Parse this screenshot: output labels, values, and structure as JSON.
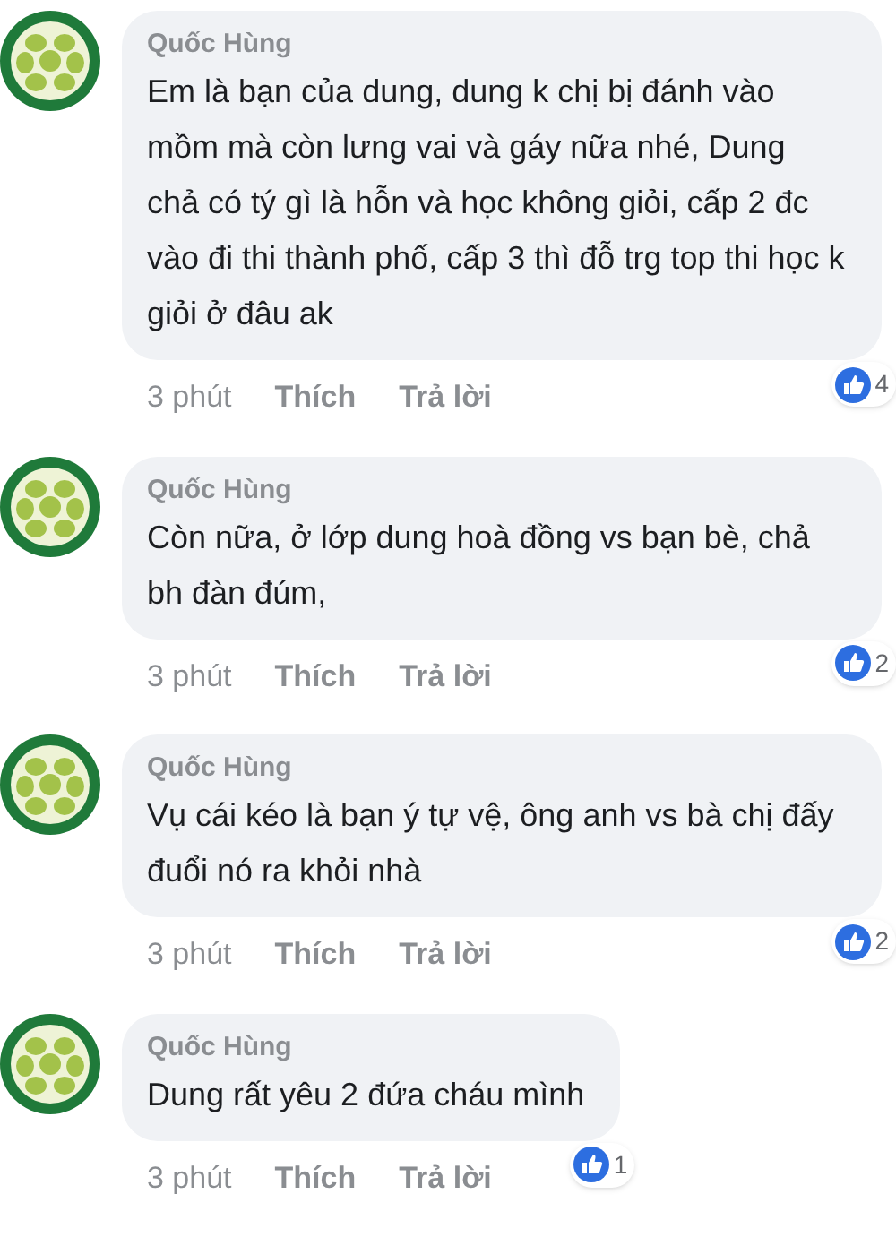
{
  "comments": [
    {
      "author": "Quốc Hùng",
      "text": "Em là bạn của dung, dung k chị bị đánh vào mồm mà còn lưng vai và gáy nữa nhé, Dung chả có tý gì là hỗn và học không giỏi, cấp 2 đc vào đi thi thành phố, cấp 3 thì đỗ trg top thi học k giỏi ở đâu ak",
      "time": "3 phút",
      "like": "Thích",
      "reply": "Trả lời",
      "reactions": "4"
    },
    {
      "author": "Quốc Hùng",
      "text": "Còn nữa, ở lớp dung hoà đồng vs bạn bè, chả bh đàn đúm,",
      "time": "3 phút",
      "like": "Thích",
      "reply": "Trả lời",
      "reactions": "2"
    },
    {
      "author": "Quốc Hùng",
      "text": "Vụ cái kéo là bạn ý tự vệ, ông anh vs bà chị đấy đuổi nó ra khỏi nhà",
      "time": "3 phút",
      "like": "Thích",
      "reply": "Trả lời",
      "reactions": "2"
    },
    {
      "author": "Quốc Hùng",
      "text": "Dung rất yêu 2 đứa cháu mình",
      "time": "3 phút",
      "like": "Thích",
      "reply": "Trả lời",
      "reactions": "1"
    }
  ]
}
